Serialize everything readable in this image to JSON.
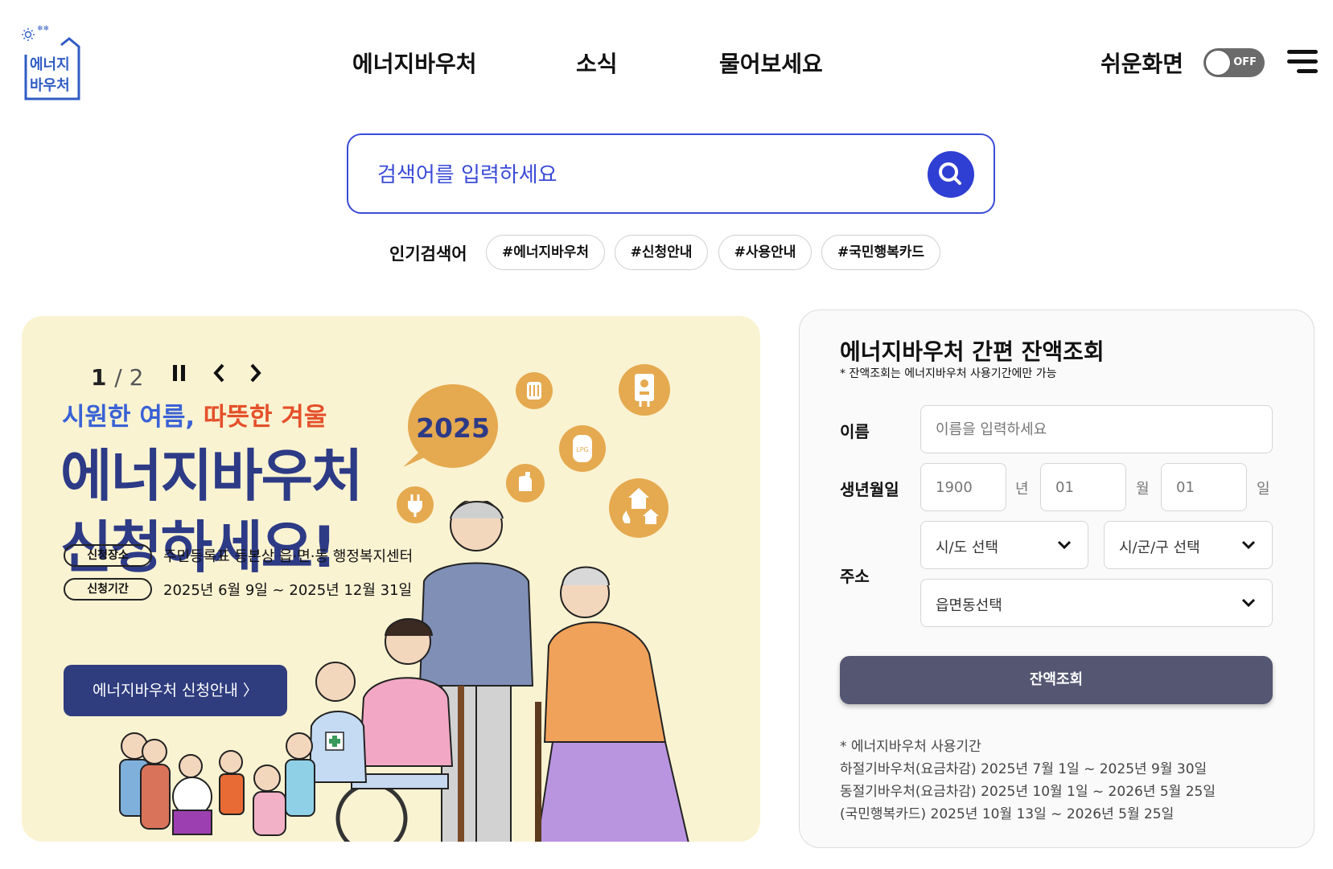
{
  "logo": {
    "line1": "에너지",
    "line2": "바우처"
  },
  "nav": {
    "items": [
      "에너지바우처",
      "소식",
      "물어보세요"
    ]
  },
  "easy_screen": {
    "label": "쉬운화면",
    "toggle_state": "OFF"
  },
  "search": {
    "placeholder": "검색어를 입력하세요",
    "popular_label": "인기검색어",
    "tags": [
      "#에너지바우처",
      "#신청안내",
      "#사용안내",
      "#국민행복카드"
    ]
  },
  "banner": {
    "pager_current": "1",
    "pager_total": "/ 2",
    "subtitle_cool": "시원한 여름,",
    "subtitle_warm": "따뜻한 겨울",
    "title_line1": "에너지바우처",
    "title_line2": "신청하세요!",
    "year_badge": "2025",
    "place_pill": "신청장소",
    "place_text": "주민등록표 등본상 읍·면·동 행정복지센터",
    "period_pill": "신청기간",
    "period_text": "2025년 6월 9일 ~ 2025년 12월 31일",
    "cta_label": "에너지바우처 신청안내 〉",
    "lpg_label": "LPG"
  },
  "balance": {
    "title": "에너지바우처 간편 잔액조회",
    "note": "* 잔액조회는 에너지바우처 사용기간에만 가능",
    "name_label": "이름",
    "name_placeholder": "이름을 입력하세요",
    "birth_label": "생년월일",
    "year_placeholder": "1900",
    "year_unit": "년",
    "month_placeholder": "01",
    "month_unit": "월",
    "day_placeholder": "01",
    "day_unit": "일",
    "address_label": "주소",
    "sido_select": "시/도 선택",
    "sigungu_select": "시/군/구 선택",
    "eupmyeondong_select": "읍면동선택",
    "submit_label": "잔액조회",
    "period_header": "* 에너지바우처 사용기간",
    "period_lines": [
      "하절기바우처(요금차감) 2025년 7월 1일 ~ 2025년 9월 30일",
      "동절기바우처(요금차감) 2025년 10월 1일 ~ 2026년 5월 25일",
      "(국민행복카드) 2025년 10월 13일 ~ 2026년 5월 25일"
    ]
  },
  "colors": {
    "brand_blue": "#2f3fd3",
    "banner_bg": "#faf3d2",
    "banner_navy": "#2d3a86",
    "accent_orange": "#e5a94f",
    "warm_red": "#e4502a",
    "submit_gray": "#545672"
  }
}
